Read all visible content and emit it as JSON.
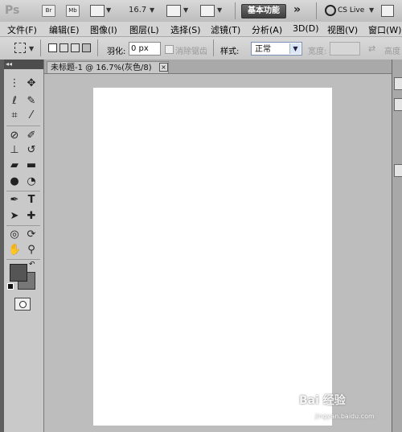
{
  "appbar": {
    "logo": "Ps",
    "bridge_label": "Br",
    "minibridge_label": "Mb",
    "zoom_value": "16.7",
    "workspace_button": "基本功能",
    "more_chevron": "»",
    "cslive_label": "CS Live"
  },
  "menubar": {
    "items": [
      "文件(F)",
      "编辑(E)",
      "图像(I)",
      "图层(L)",
      "选择(S)",
      "滤镜(T)",
      "分析(A)",
      "3D(D)",
      "视图(V)",
      "窗口(W)"
    ]
  },
  "options": {
    "feather_label": "羽化:",
    "feather_value": "0 px",
    "antialias_label": "消除锯齿",
    "style_label": "样式:",
    "style_value": "正常",
    "width_label": "宽度:",
    "height_label": "高度"
  },
  "tools": {
    "icons": [
      "move-icon",
      "marquee-icon",
      "lasso-icon",
      "quick-selection-icon",
      "crop-icon",
      "eyedropper-icon",
      "spot-healing-icon",
      "brush-icon",
      "clone-stamp-icon",
      "history-brush-icon",
      "eraser-icon",
      "gradient-icon",
      "blur-icon",
      "dodge-icon",
      "pen-icon",
      "type-icon",
      "path-selection-icon",
      "custom-shape-icon",
      "3d-rotate-icon",
      "3d-orbit-icon",
      "hand-icon",
      "zoom-icon"
    ]
  },
  "document": {
    "tab_title": "未标题-1 @ 16.7%(灰色/8)",
    "close_glyph": "×"
  },
  "colors": {
    "foreground": "#555555",
    "background": "#777777",
    "canvas": "#ffffff"
  },
  "watermark": {
    "text": "Bai 经验",
    "url": "jingyan.baidu.com"
  }
}
